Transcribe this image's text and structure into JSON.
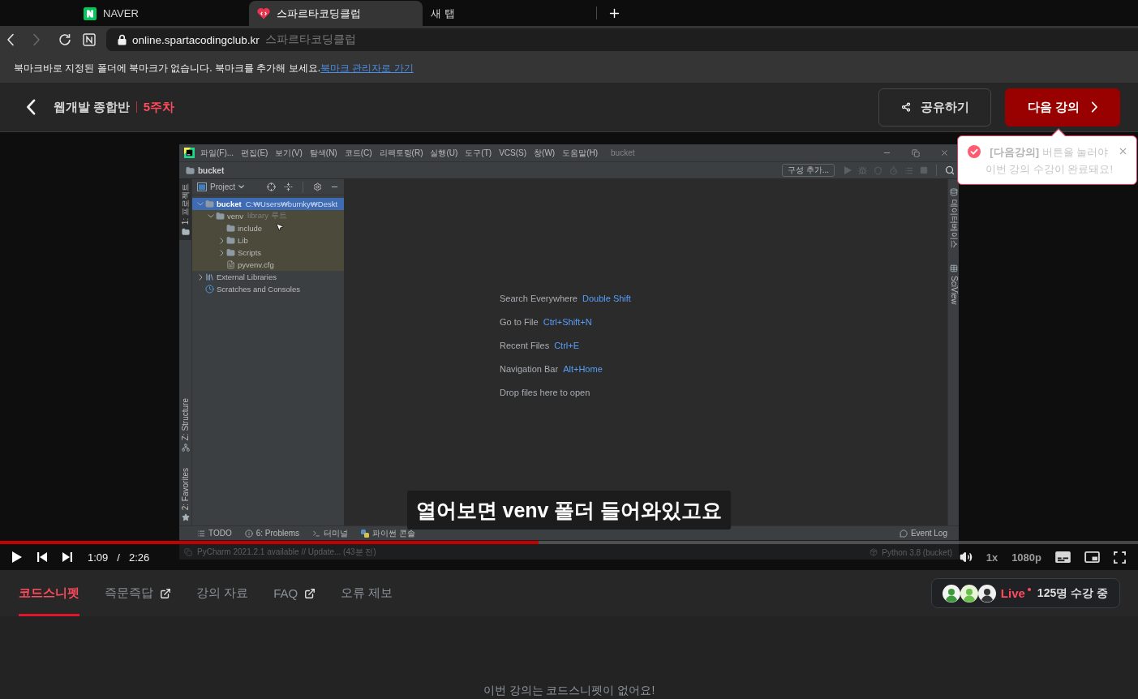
{
  "browser": {
    "tabs": [
      {
        "title": "NAVER",
        "kind": "n_logo",
        "selected": false
      },
      {
        "title": "스파르타코딩클럽",
        "kind": "heart",
        "selected": true
      },
      {
        "title": "새 탭",
        "kind": "blank",
        "selected": false
      }
    ],
    "forward_disabled": true,
    "address": {
      "domain": "online.spartacodingclub.kr",
      "page_title": "스파르타코딩클럽"
    }
  },
  "bookmark_bar": {
    "message": "북마크바로 지정된 폴더에 북마크가 없습니다. 북마크를 추가해 보세요.",
    "link": "북마크 관리자로 가기"
  },
  "header": {
    "course": "웹개발 종합반",
    "week": "5주차",
    "share_button": "공유하기",
    "next_button": "다음 강의"
  },
  "tooltip": {
    "message": "**[다음강의]** 버튼을 눌러야\n이번 강의 수강이 완료돼요!"
  },
  "video": {
    "ide": {
      "menu": [
        "파일(F)...",
        "편집(E)",
        "보기(V)",
        "탐색(N)",
        "코드(C)",
        "리팩토링(R)",
        "실행(U)",
        "도구(T)",
        "VCS(S)",
        "창(W)",
        "도움말(H)"
      ],
      "title": "bucket",
      "breadcrumb": "bucket",
      "run_config": "구성 추가...",
      "left_tools_top": [
        {
          "label": "1: 프로젝트",
          "kind": "project",
          "selected": true
        }
      ],
      "left_tools_bottom": [
        {
          "label": "Z: Structure",
          "kind": "structure",
          "selected": false
        },
        {
          "label": "2: Favorites",
          "kind": "favorites",
          "selected": false
        }
      ],
      "right_tools": [
        {
          "label": "데이터베이스",
          "kind": "database",
          "selected": false
        },
        {
          "label": "SciView",
          "kind": "sciview",
          "selected": false
        }
      ],
      "project_panel": {
        "title": "Project",
        "tree": [
          {
            "label": "bucket",
            "detail": "C:₩Users₩bumky₩Deskt",
            "kind": "folder",
            "expanded": true,
            "selected": true,
            "highlighted": false,
            "children": [
              {
                "label": "venv",
                "detail": "library 루트",
                "kind": "folder",
                "expanded": true,
                "selected": false,
                "highlighted": true,
                "children": [
                  {
                    "label": "include",
                    "kind": "folder",
                    "selected": false,
                    "highlighted": true
                  },
                  {
                    "label": "Lib",
                    "kind": "folder",
                    "expanded": false,
                    "selected": false,
                    "highlighted": true
                  },
                  {
                    "label": "Scripts",
                    "kind": "folder",
                    "expanded": false,
                    "selected": false,
                    "highlighted": true
                  },
                  {
                    "label": "pyvenv.cfg",
                    "kind": "file",
                    "selected": false,
                    "highlighted": true
                  }
                ]
              }
            ]
          },
          {
            "label": "External Libraries",
            "kind": "libraries",
            "expanded": false,
            "selected": false,
            "highlighted": false
          },
          {
            "label": "Scratches and Consoles",
            "kind": "scratches",
            "selected": false,
            "highlighted": false
          }
        ]
      },
      "hints": [
        {
          "action": "Search Everywhere",
          "shortcut": "Double Shift"
        },
        {
          "action": "Go to File",
          "shortcut": "Ctrl+Shift+N"
        },
        {
          "action": "Recent Files",
          "shortcut": "Ctrl+E"
        },
        {
          "action": "Navigation Bar",
          "shortcut": "Alt+Home"
        },
        {
          "action": "Drop files here to open"
        }
      ],
      "bottom_tools": [
        {
          "label": "TODO",
          "kind": "todo"
        },
        {
          "label": "6: Problems",
          "kind": "problems"
        },
        {
          "label": "터미널",
          "kind": "terminal"
        },
        {
          "label": "파이썬 콘솔",
          "kind": "console"
        }
      ],
      "event_log": "Event Log",
      "status": {
        "message": "PyCharm 2021.2.1 available // Update... (43분 전)",
        "interpreter": "Python 3.8 (bucket)"
      }
    },
    "subtitle": "열어보면 venv 폴더 들어와있고요",
    "player": {
      "playing": false,
      "level": 0.473,
      "current_time": "1:09",
      "separator": "/",
      "duration": "2:26",
      "speed": "1x",
      "quality": "1080p"
    }
  },
  "lecture_tabs": [
    {
      "label": "코드스니펫",
      "selected": true,
      "external": false
    },
    {
      "label": "즉문즉답",
      "selected": false,
      "external": true
    },
    {
      "label": "강의 자료",
      "selected": false,
      "external": false
    },
    {
      "label": "FAQ",
      "selected": false,
      "external": true
    },
    {
      "label": "오류 제보",
      "selected": false,
      "external": false
    }
  ],
  "live": {
    "label": "Live",
    "viewers": "125명 수강 중"
  },
  "snippet_empty": "이번 강의는 코드스니펫이 없어요!"
}
